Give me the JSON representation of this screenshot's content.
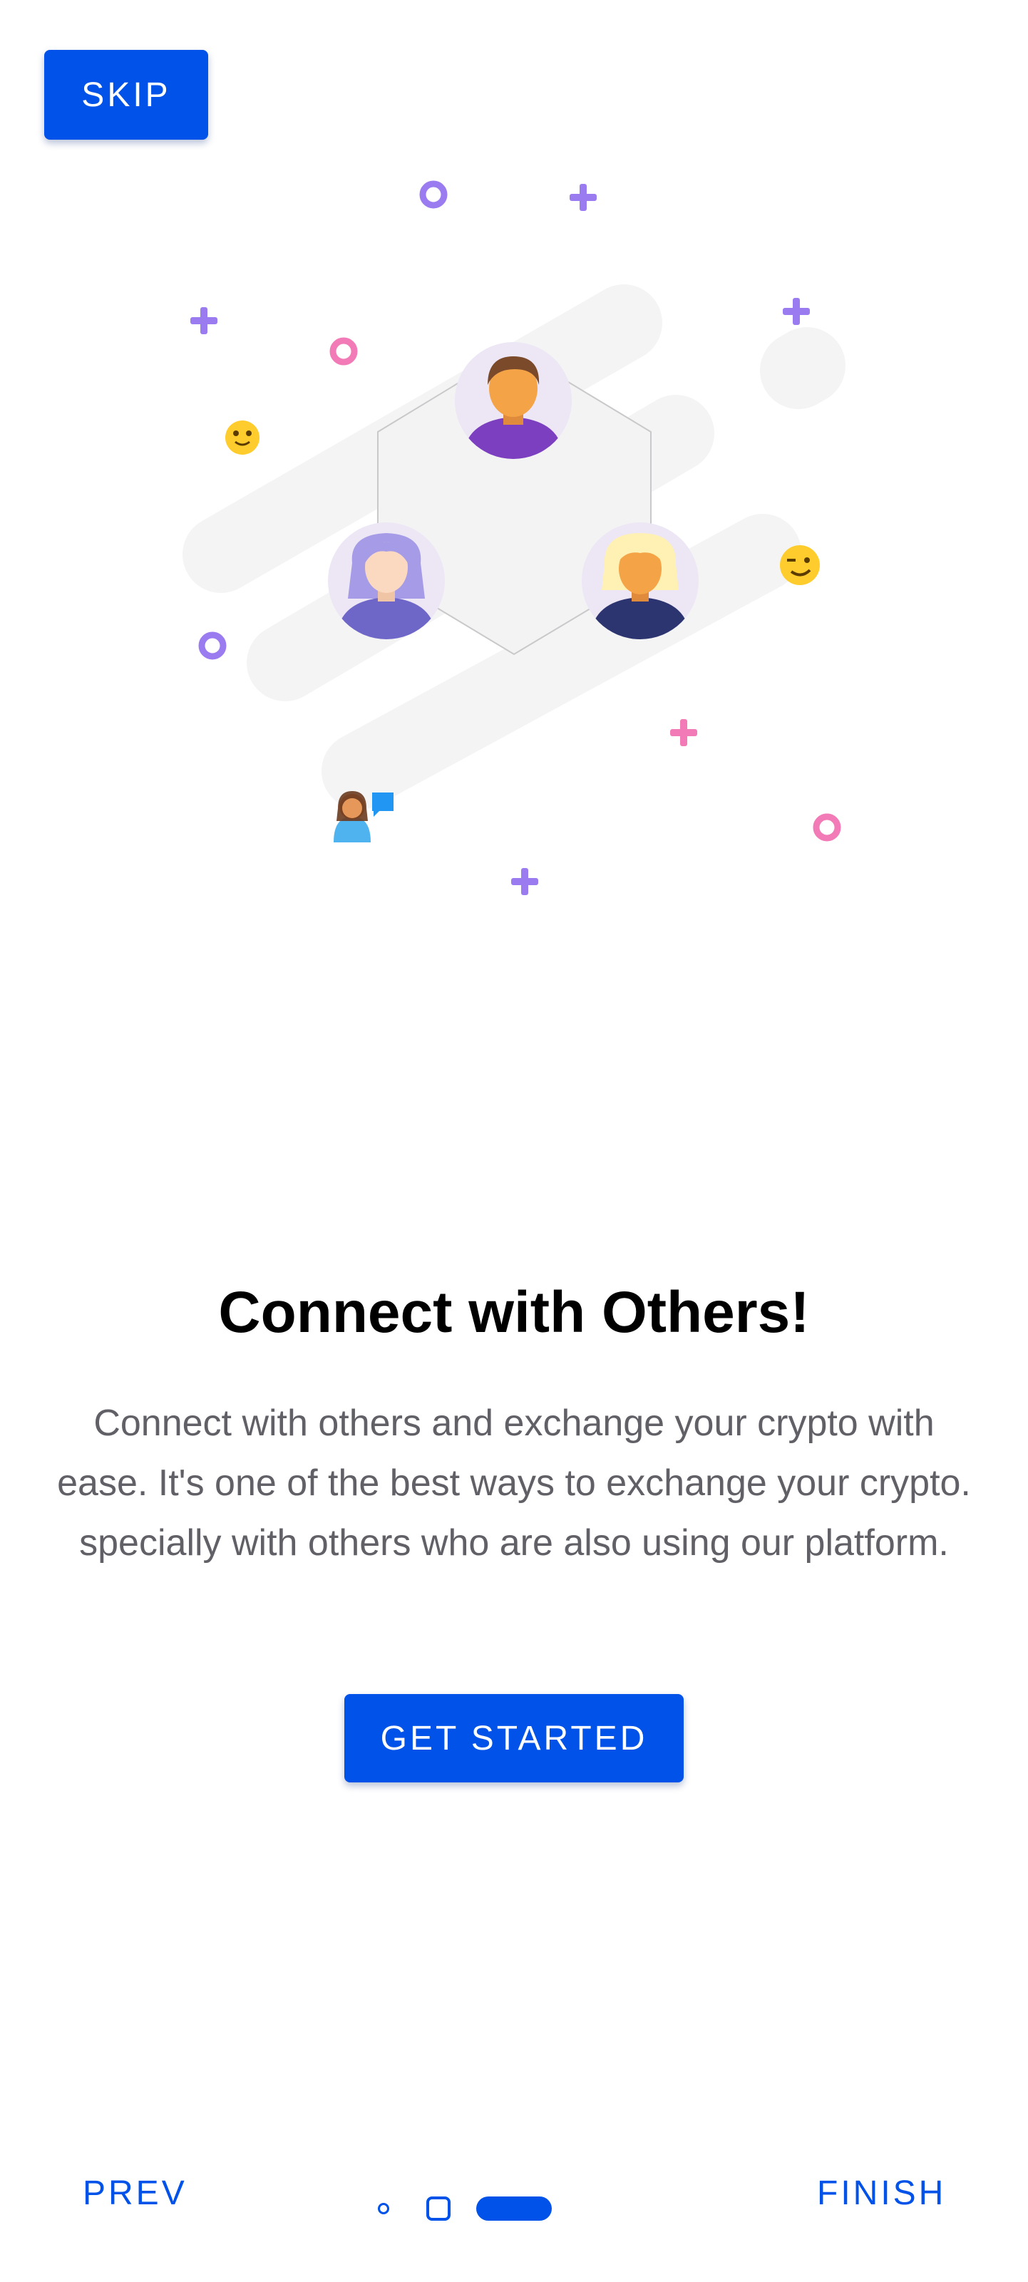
{
  "header": {
    "skip_label": "SKIP"
  },
  "illustration": {
    "description_icons": [
      "person-icon",
      "speech-bubble-icon",
      "emoji-icon",
      "sparkle-icon",
      "ring-icon"
    ]
  },
  "content": {
    "title": "Connect with Others!",
    "description": "Connect with others and exchange your crypto with ease. It's one of the best ways to exchange your crypto. specially with others who are also using our platform.",
    "cta_label": "GET STARTED"
  },
  "footer": {
    "prev_label": "PREV",
    "finish_label": "FINISH",
    "page_count": 3,
    "current_page": 3
  },
  "colors": {
    "primary": "#0052e8",
    "description_text": "#606066",
    "title_text": "#000000",
    "sparkle_purple": "#9b7bf0",
    "sparkle_pink": "#f27ab6",
    "avatar_background": "#ece6f5"
  }
}
